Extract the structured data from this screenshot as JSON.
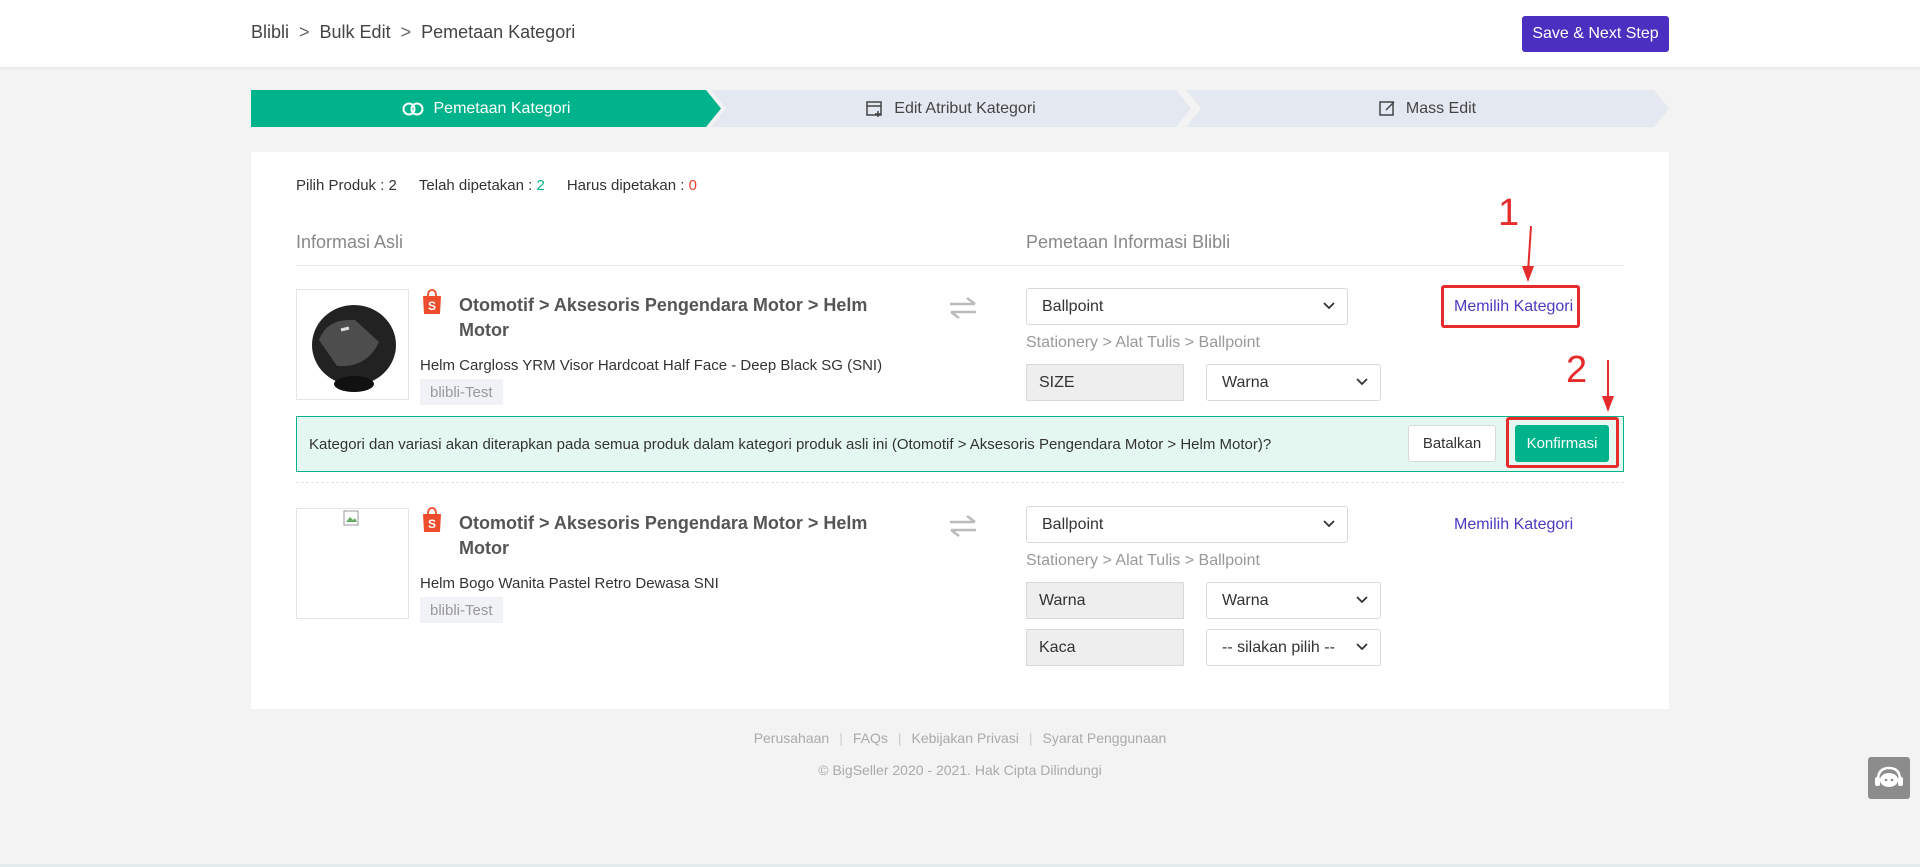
{
  "header": {
    "breadcrumb": [
      "Blibli",
      ">",
      "Bulk Edit",
      ">",
      "Pemetaan Kategori"
    ],
    "save_label": "Save & Next Step"
  },
  "steps": [
    {
      "label": "Pemetaan Kategori",
      "icon": "link-icon",
      "active": true
    },
    {
      "label": "Edit Atribut Kategori",
      "icon": "add-window-icon",
      "active": false
    },
    {
      "label": "Mass Edit",
      "icon": "edit-icon",
      "active": false
    }
  ],
  "stats": {
    "pilih_label": "Pilih Produk : 2",
    "dipetakan_label": "Telah dipetakan : ",
    "dipetakan_value": "2",
    "harus_label": "Harus dipetakan : ",
    "harus_value": "0"
  },
  "columns": {
    "left": "Informasi Asli",
    "right": "Pemetaan Informasi Blibli"
  },
  "products": [
    {
      "category_path": "Otomotif > Aksesoris Pengendara Motor > Helm Motor",
      "name": "Helm Cargloss YRM Visor Hardcoat Half Face - Deep Black SG (SNI)",
      "shop": "blibli-Test",
      "mapped_category": "Ballpoint",
      "mapped_path": "Stationery > Alat Tulis > Ballpoint",
      "attributes": [
        {
          "label": "SIZE",
          "value": "Warna"
        }
      ],
      "link": "Memilih Kategori"
    },
    {
      "category_path": "Otomotif > Aksesoris Pengendara Motor > Helm Motor",
      "name": "Helm Bogo Wanita Pastel Retro Dewasa SNI",
      "shop": "blibli-Test",
      "mapped_category": "Ballpoint",
      "mapped_path": "Stationery > Alat Tulis > Ballpoint",
      "attributes": [
        {
          "label": "Warna",
          "value": "Warna"
        },
        {
          "label": "Kaca",
          "value": "-- silakan pilih --"
        }
      ],
      "link": "Memilih Kategori"
    }
  ],
  "confirm": {
    "text": "Kategori dan variasi akan diterapkan pada semua produk dalam kategori produk asli ini (Otomotif > Aksesoris Pengendara Motor > Helm Motor)?",
    "cancel": "Batalkan",
    "confirm": "Konfirmasi"
  },
  "annotations": [
    "1",
    "2"
  ],
  "annotation_color": "#e52b2b",
  "accent_color": "#00b38a",
  "brand_color": "#4b2fc0",
  "footer": {
    "links": [
      "Perusahaan",
      "FAQs",
      "Kebijakan Privasi",
      "Syarat Penggunaan"
    ],
    "copyright": "© BigSeller 2020 - 2021. Hak Cipta Dilindungi"
  }
}
